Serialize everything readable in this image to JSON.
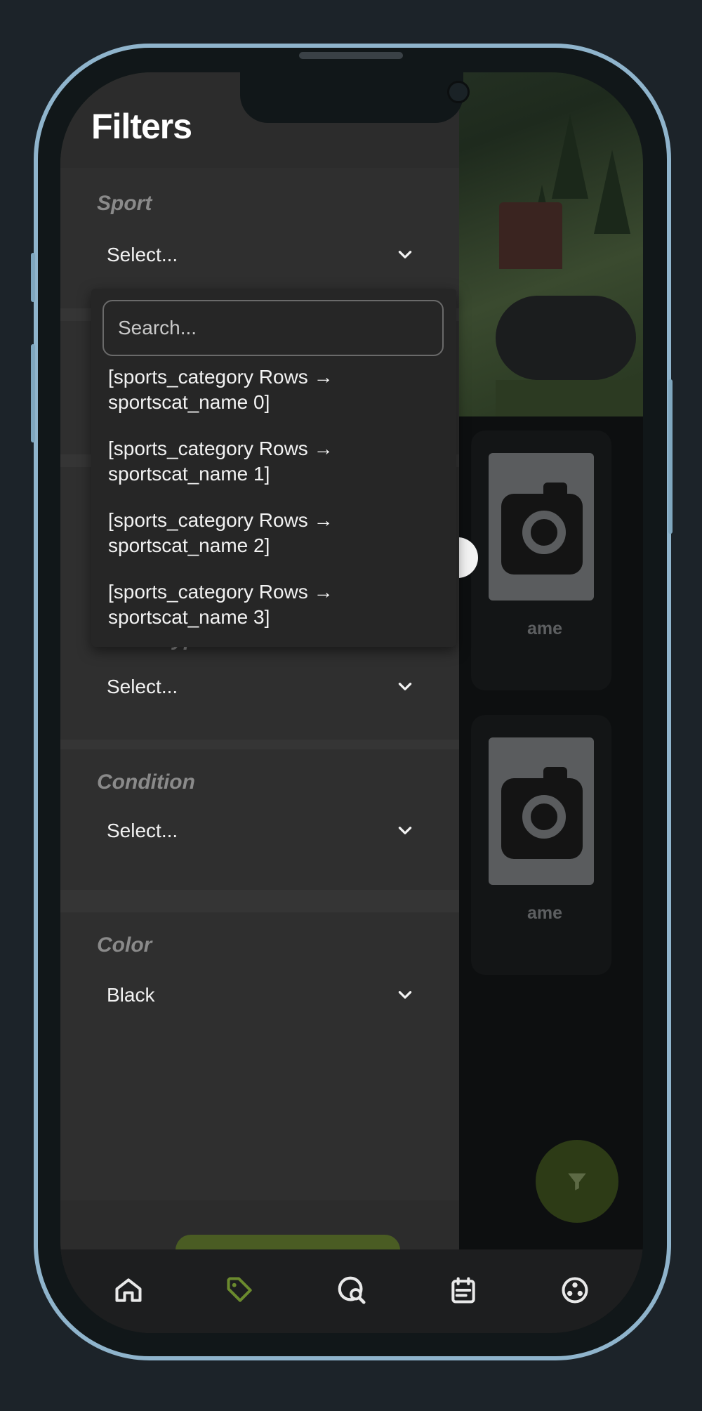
{
  "drawer": {
    "title": "Filters",
    "sections": [
      {
        "label": "Sport",
        "value": "Select..."
      },
      {
        "label": "Seller Type",
        "value": "Select..."
      },
      {
        "label": "Condition",
        "value": "Select..."
      },
      {
        "label": "Color",
        "value": "Black"
      }
    ]
  },
  "dropdown": {
    "search_placeholder": "Search...",
    "options": [
      "[sports_category Rows → sportscat_name 0]",
      "[sports_category Rows → sportscat_name 1]",
      "[sports_category Rows → sportscat_name 2]",
      "[sports_category Rows → sportscat_name 3]"
    ]
  },
  "background": {
    "card_labels": [
      "ame",
      "ame"
    ]
  },
  "nav": {
    "items": [
      "home-icon",
      "tag-icon",
      "search-sport-icon",
      "calendar-icon",
      "ball-icon"
    ],
    "active": "tag-icon"
  },
  "colors": {
    "accent": "#6b8a2e",
    "drawer_bg": "#2c2c2c",
    "text": "#f2f2f2",
    "label": "#8a8a8a"
  }
}
